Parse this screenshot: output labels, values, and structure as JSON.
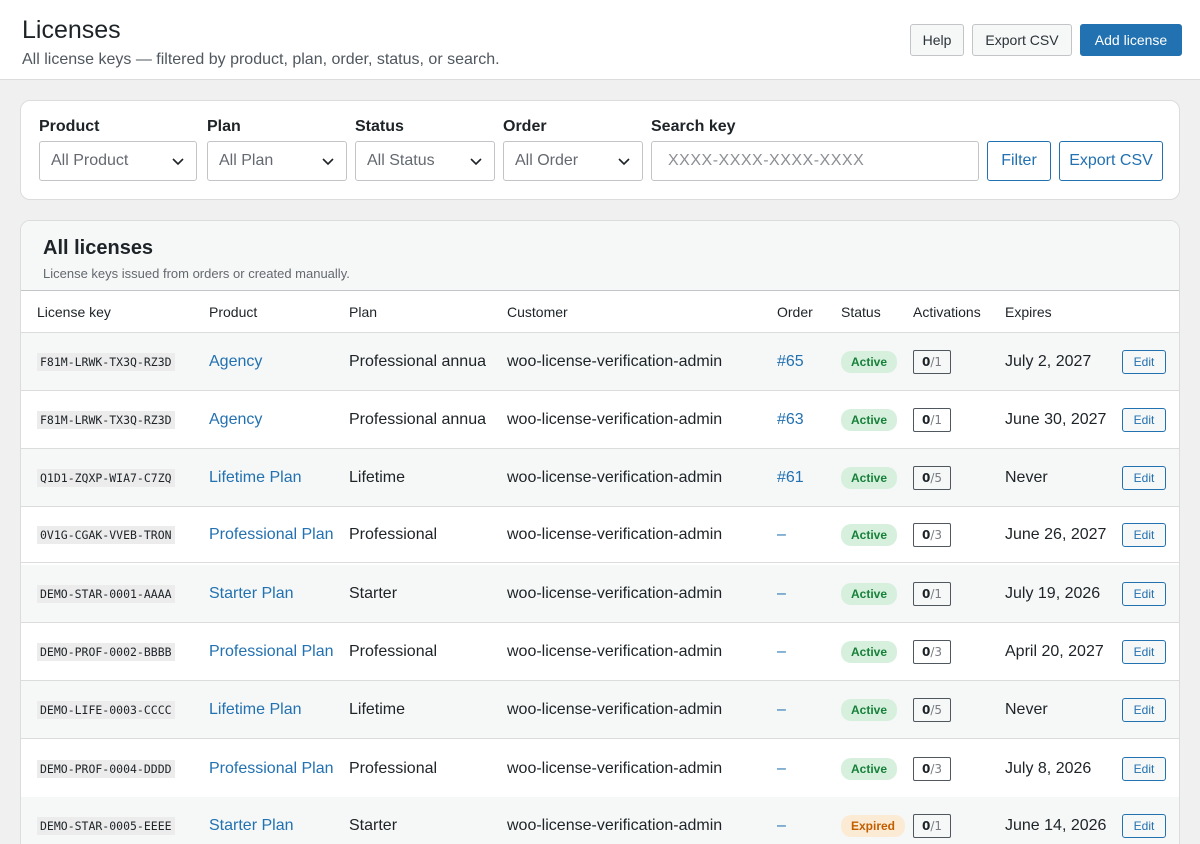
{
  "header": {
    "title": "Licenses",
    "subtitle": "All license keys — filtered by product, plan, order, status, or search.",
    "help_label": "Help",
    "export_label": "Export CSV",
    "add_label": "Add license"
  },
  "filters": {
    "product_label": "Product",
    "product_value": "All Product",
    "plan_label": "Plan",
    "plan_value": "All Plan",
    "status_label": "Status",
    "status_value": "All Status",
    "order_label": "Order",
    "order_value": "All Order",
    "search_label": "Search key",
    "search_placeholder": "XXXX-XXXX-XXXX-XXXX",
    "filter_label": "Filter",
    "export_label": "Export CSV"
  },
  "table": {
    "title": "All licenses",
    "subtitle": "License keys issued from orders or created manually.",
    "columns": [
      "License key",
      "Product",
      "Plan",
      "Customer",
      "Order",
      "Status",
      "Activations",
      "Expires"
    ],
    "rows": [
      {
        "key": "F81M-LRWK-TX3Q-RZ3D",
        "product": "Agency",
        "plan": "Professional annual",
        "customer": "woo-license-verification-admin",
        "order": "#65",
        "status": "Active",
        "used": "0",
        "total": "/1",
        "expires": "July 2, 2027",
        "edit": "Edit"
      },
      {
        "key": "F81M-LRWK-TX3Q-RZ3D",
        "product": "Agency",
        "plan": "Professional annual",
        "customer": "woo-license-verification-admin",
        "order": "#63",
        "status": "Active",
        "used": "0",
        "total": "/1",
        "expires": "June 30, 2027",
        "edit": "Edit"
      },
      {
        "key": "Q1D1-ZQXP-WIA7-C7ZQ",
        "product": "Lifetime Plan",
        "plan": "Lifetime",
        "customer": "woo-license-verification-admin",
        "order": "#61",
        "status": "Active",
        "used": "0",
        "total": "/5",
        "expires": "Never",
        "edit": "Edit"
      },
      {
        "key": "0V1G-CGAK-VVEB-TRON",
        "product": "Professional Plan",
        "plan": "Professional",
        "customer": "woo-license-verification-admin",
        "order": "–",
        "status": "Active",
        "used": "0",
        "total": "/3",
        "expires": "June 26, 2027",
        "edit": "Edit"
      },
      {
        "key": "DEMO-STAR-0001-AAAA",
        "product": "Starter Plan",
        "plan": "Starter",
        "customer": "woo-license-verification-admin",
        "order": "–",
        "status": "Active",
        "used": "0",
        "total": "/1",
        "expires": "July 19, 2026",
        "edit": "Edit"
      },
      {
        "key": "DEMO-PROF-0002-BBBB",
        "product": "Professional Plan",
        "plan": "Professional",
        "customer": "woo-license-verification-admin",
        "order": "–",
        "status": "Active",
        "used": "0",
        "total": "/3",
        "expires": "April 20, 2027",
        "edit": "Edit"
      },
      {
        "key": "DEMO-LIFE-0003-CCCC",
        "product": "Lifetime Plan",
        "plan": "Lifetime",
        "customer": "woo-license-verification-admin",
        "order": "–",
        "status": "Active",
        "used": "0",
        "total": "/5",
        "expires": "Never",
        "edit": "Edit"
      },
      {
        "key": "DEMO-PROF-0004-DDDD",
        "product": "Professional Plan",
        "plan": "Professional",
        "customer": "woo-license-verification-admin",
        "order": "–",
        "status": "Active",
        "used": "0",
        "total": "/3",
        "expires": "July 8, 2026",
        "edit": "Edit"
      },
      {
        "key": "DEMO-STAR-0005-EEEE",
        "product": "Starter Plan",
        "plan": "Starter",
        "customer": "woo-license-verification-admin",
        "order": "–",
        "status": "Expired",
        "used": "0",
        "total": "/1",
        "expires": "June 14, 2026",
        "edit": "Edit"
      }
    ]
  },
  "colors": {
    "accent": "#2271b1",
    "active_bg": "#d7f0dd",
    "active_fg": "#17803a",
    "expired_bg": "#fcebd4",
    "expired_fg": "#c25d00"
  },
  "icons": {
    "select_arrow": "chevron-down-icon"
  }
}
